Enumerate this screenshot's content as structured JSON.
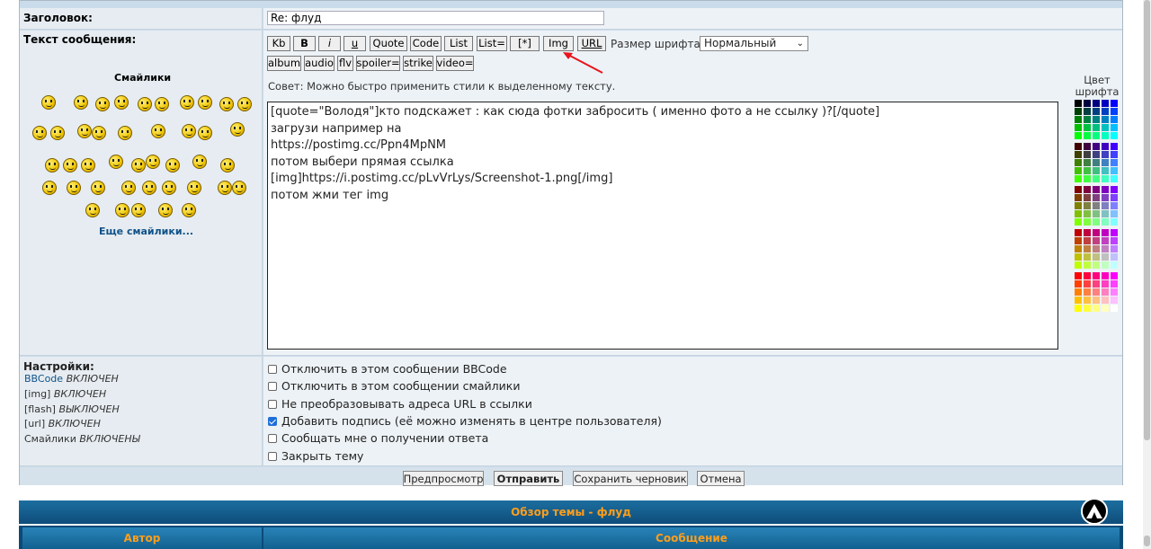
{
  "form": {
    "subject_label": "Заголовок:",
    "subject_value": "Re: флуд",
    "message_label": "Текст сообщения:"
  },
  "smilies": {
    "title": "Смайлики",
    "more_link": "Еще смайлики..."
  },
  "toolbar": {
    "buttons": [
      "Kb",
      "B",
      "i",
      "u",
      "Quote",
      "Code",
      "List",
      "List=",
      "[*]",
      "Img",
      "URL"
    ],
    "buttons_row2": [
      "album",
      "audio",
      "flv",
      "spoiler=",
      "strike",
      "video="
    ],
    "font_size_label": "Размер шрифта:",
    "font_size_value": "Нормальный",
    "tip": "Совет: Можно быстро применить стили к выделенному тексту."
  },
  "message_text": "[quote=\"Володя\"]кто подскажет : как сюда фотки забросить ( именно фото а не ссылку )?[/quote]\nзагрузи например на\nhttps://postimg.cc/Ppn4MpNM\nпотом выбери прямая ссылка\n[img]https://i.postimg.cc/pLvVrLys/Screenshot-1.png[/img]\nпотом жми тег img",
  "color_palette": {
    "label": "Цвет шрифта",
    "colors": [
      [
        "#000000",
        "#000040",
        "#000080",
        "#0000c0",
        "#0000ff"
      ],
      [
        "#004000",
        "#004040",
        "#004080",
        "#0040c0",
        "#0040ff"
      ],
      [
        "#008000",
        "#008040",
        "#008080",
        "#0080c0",
        "#0080ff"
      ],
      [
        "#00c000",
        "#00c040",
        "#00c080",
        "#00c0c0",
        "#00c0ff"
      ],
      [
        "#00ff00",
        "#00ff40",
        "#00ff80",
        "#00ffc0",
        "#00ffff"
      ],
      [
        "#400000",
        "#400040",
        "#400080",
        "#4000c0",
        "#4000ff"
      ],
      [
        "#404000",
        "#404040",
        "#404080",
        "#4040c0",
        "#4040ff"
      ],
      [
        "#408000",
        "#408040",
        "#408080",
        "#4080c0",
        "#4080ff"
      ],
      [
        "#40c000",
        "#40c040",
        "#40c080",
        "#40c0c0",
        "#40c0ff"
      ],
      [
        "#40ff00",
        "#40ff40",
        "#40ff80",
        "#40ffc0",
        "#40ffff"
      ],
      [
        "#800000",
        "#800040",
        "#800080",
        "#8000c0",
        "#8000ff"
      ],
      [
        "#804000",
        "#804040",
        "#804080",
        "#8040c0",
        "#8040ff"
      ],
      [
        "#808000",
        "#808040",
        "#808080",
        "#8080c0",
        "#8080ff"
      ],
      [
        "#80c000",
        "#80c040",
        "#80c080",
        "#80c0c0",
        "#80c0ff"
      ],
      [
        "#80ff00",
        "#80ff40",
        "#80ff80",
        "#80ffc0",
        "#80ffff"
      ],
      [
        "#c00000",
        "#c00040",
        "#c00080",
        "#c000c0",
        "#c000ff"
      ],
      [
        "#c04000",
        "#c04040",
        "#c04080",
        "#c040c0",
        "#c040ff"
      ],
      [
        "#c08000",
        "#c08040",
        "#c08080",
        "#c080c0",
        "#c080ff"
      ],
      [
        "#c0c000",
        "#c0c040",
        "#c0c080",
        "#c0c0c0",
        "#c0c0ff"
      ],
      [
        "#c0ff00",
        "#c0ff40",
        "#c0ff80",
        "#c0ffc0",
        "#c0ffff"
      ],
      [
        "#ff0000",
        "#ff0040",
        "#ff0080",
        "#ff00c0",
        "#ff00ff"
      ],
      [
        "#ff4000",
        "#ff4040",
        "#ff4080",
        "#ff40c0",
        "#ff40ff"
      ],
      [
        "#ff8000",
        "#ff8040",
        "#ff8080",
        "#ff80c0",
        "#ff80ff"
      ],
      [
        "#ffc000",
        "#ffc040",
        "#ffc080",
        "#ffc0c0",
        "#ffc0ff"
      ],
      [
        "#ffff00",
        "#ffff40",
        "#ffff80",
        "#ffffc0",
        "#ffffff"
      ]
    ]
  },
  "settings": {
    "title": "Настройки:",
    "lines": [
      {
        "key": "BBCode",
        "value": "ВКЛЮЧЕН"
      },
      {
        "key": "[img]",
        "value": "ВКЛЮЧЕН"
      },
      {
        "key": "[flash]",
        "value": "ВЫКЛЮЧЕН"
      },
      {
        "key": "[url]",
        "value": "ВКЛЮЧЕН"
      },
      {
        "key": "Смайлики",
        "value": "ВКЛЮЧЕНЫ"
      }
    ],
    "checkboxes": [
      {
        "label": "Отключить в этом сообщении BBCode",
        "checked": false
      },
      {
        "label": "Отключить в этом сообщении смайлики",
        "checked": false
      },
      {
        "label": "Не преобразовывать адреса URL в ссылки",
        "checked": false
      },
      {
        "label": "Добавить подпись (её можно изменять в центре пользователя)",
        "checked": true
      },
      {
        "label": "Сообщать мне о получении ответа",
        "checked": false
      },
      {
        "label": "Закрыть тему",
        "checked": false
      }
    ]
  },
  "actions": {
    "preview": "Предпросмотр",
    "submit": "Отправить",
    "save_draft": "Сохранить черновик",
    "cancel": "Отмена"
  },
  "topic_review": {
    "title": "Обзор темы - флуд",
    "col_author": "Автор",
    "col_message": "Сообщение"
  },
  "colors": {
    "header_blue": "#0e4d7a",
    "header_text_orange": "#ff9e1a",
    "link_blue": "#105289",
    "annotation_red": "#e8141c"
  }
}
